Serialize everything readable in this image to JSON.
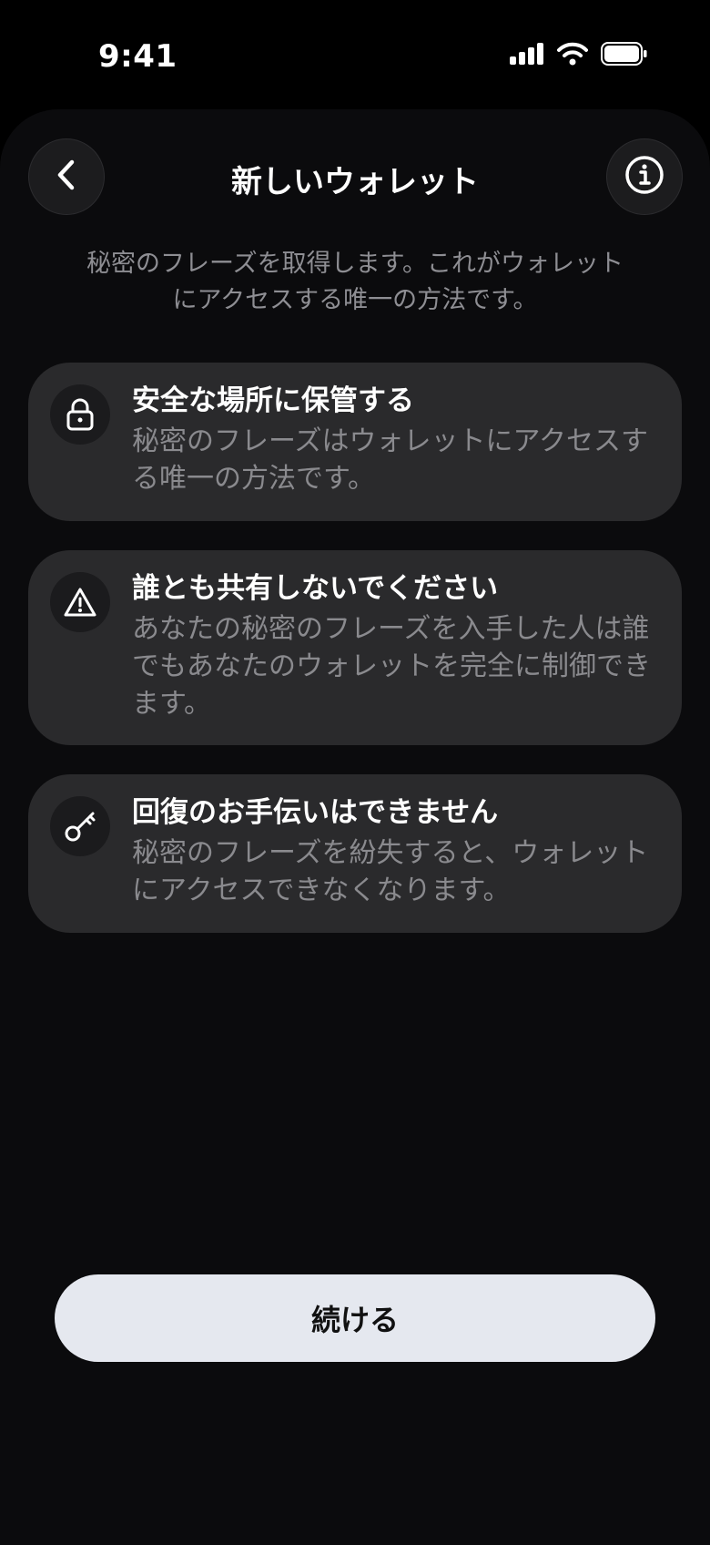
{
  "status_bar": {
    "time": "9:41"
  },
  "header": {
    "title": "新しいウォレット",
    "back_icon": "chevron-left-icon",
    "info_icon": "info-circle-icon"
  },
  "intro": {
    "text": "秘密のフレーズを取得します。これがウォレットにアクセスする唯一の方法です。"
  },
  "cards": [
    {
      "icon": "lock-icon",
      "title": "安全な場所に保管する",
      "body": "秘密のフレーズはウォレットにアクセスする唯一の方法です。"
    },
    {
      "icon": "warning-triangle-icon",
      "title": "誰とも共有しないでください",
      "body": "あなたの秘密のフレーズを入手した人は誰でもあなたのウォレットを完全に制御できます。"
    },
    {
      "icon": "key-icon",
      "title": "回復のお手伝いはできません",
      "body": "秘密のフレーズを紛失すると、ウォレットにアクセスできなくなります。"
    }
  ],
  "footer": {
    "continue_label": "続ける"
  },
  "colors": {
    "background": "#000000",
    "sheet": "#0b0b0d",
    "card": "#2a2a2c",
    "muted_text": "#8e8e93",
    "button": "#e5e8ef"
  }
}
